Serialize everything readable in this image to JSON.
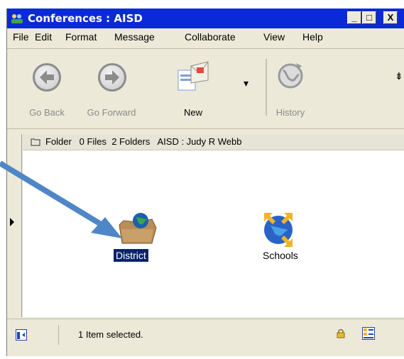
{
  "window": {
    "title": "Conferences : AISD",
    "min_label": "_",
    "max_label": "□",
    "close_label": "X"
  },
  "menu": [
    "File",
    "Edit",
    "Format",
    "Message",
    "Collaborate",
    "View",
    "Help"
  ],
  "toolbar": {
    "back_label": "Go Back",
    "forward_label": "Go Forward",
    "new_label": "New",
    "history_label": "History",
    "more_label": "⇟"
  },
  "infobar": {
    "text": "Folder   0 Files  2 Folders   AISD : Judy R Webb"
  },
  "items": [
    {
      "label": "District",
      "icon": "district-globe-folder-icon",
      "selected": true
    },
    {
      "label": "Schools",
      "icon": "schools-globe-arrows-icon",
      "selected": false
    }
  ],
  "status": {
    "text": "1 Item selected."
  },
  "colors": {
    "titlebar": "#0a2ad8",
    "selection": "#0a246a",
    "arrow": "#4f86c6"
  }
}
